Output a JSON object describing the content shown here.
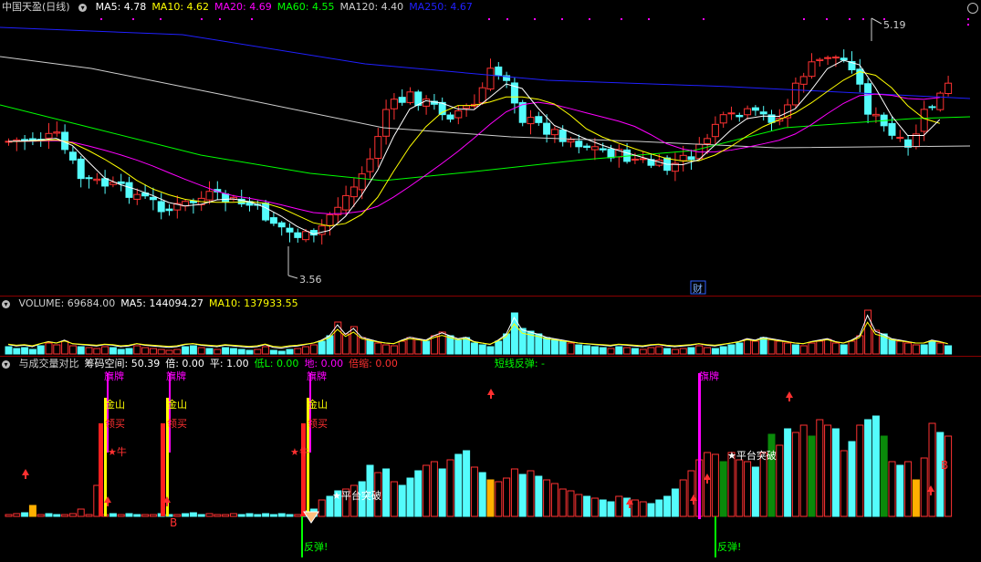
{
  "price_pane": {
    "stock_name": "中国天盈",
    "period": "(日线)",
    "ma_items": [
      {
        "label": "MA5: 4.78",
        "color": "#ffffff"
      },
      {
        "label": "MA10: 4.62",
        "color": "#ffff00"
      },
      {
        "label": "MA20: 4.69",
        "color": "#ff00ff"
      },
      {
        "label": "MA60: 4.55",
        "color": "#00ff00"
      },
      {
        "label": "MA120: 4.40",
        "color": "#cfcfcf"
      },
      {
        "label": "MA250: 4.67",
        "color": "#2020ff"
      }
    ],
    "high_label": "5.19",
    "low_label": "3.56",
    "finance_marker": "财"
  },
  "volume_pane": {
    "items": [
      {
        "label": "VOLUME: 69684.00",
        "color": "#cfcfcf"
      },
      {
        "label": "MA5: 144094.27",
        "color": "#ffffff"
      },
      {
        "label": "MA10: 137933.55",
        "color": "#ffff00"
      }
    ]
  },
  "indicator_pane": {
    "items": [
      {
        "label": "与成交量对比",
        "color": "#cfcfcf"
      },
      {
        "label": "筹码空间: 50.39",
        "color": "#ffffff"
      },
      {
        "label": "倍: 0.00",
        "color": "#ffffff"
      },
      {
        "label": "平: 1.00",
        "color": "#ffffff"
      },
      {
        "label": "低L: 0.00",
        "color": "#00ff00"
      },
      {
        "label": "地: 0.00",
        "color": "#ff00ff"
      },
      {
        "label": "倍缩: 0.00",
        "color": "#ff3030"
      },
      {
        "label": "短线反弹: -",
        "color": "#00ff00"
      }
    ],
    "signals": {
      "jinshan": "金山",
      "lingmai": "领买",
      "niu": "★牛",
      "pingtai": "★平台突破",
      "fantan": "反弹!",
      "b": "B",
      "top_cut": "旗牌"
    }
  },
  "colors": {
    "up": "#ff3232",
    "down": "#54fcfc",
    "ma5": "#ffffff",
    "ma10": "#ffff00",
    "ma20": "#ff00ff",
    "ma60": "#00ff00",
    "ma120": "#cfcfcf",
    "ma250": "#2020ff"
  }
}
